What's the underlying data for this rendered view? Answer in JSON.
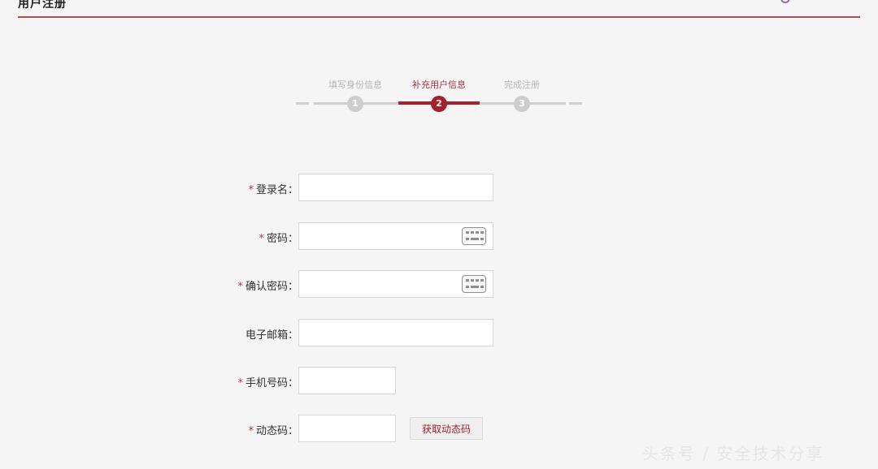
{
  "header": {
    "title": "用户注册",
    "accent_color": "#b54a55",
    "corner_icon": "circle-icon"
  },
  "stepper": {
    "steps": [
      {
        "label": "填写身份信息",
        "number": "1",
        "state": "done"
      },
      {
        "label": "补充用户信息",
        "number": "2",
        "state": "active"
      },
      {
        "label": "完成注册",
        "number": "3",
        "state": "pending"
      }
    ],
    "active_color": "#a3222e",
    "inactive_color": "#cdcdcd"
  },
  "form": {
    "fields": [
      {
        "label": "登录名：",
        "required": true,
        "value": "",
        "type": "text"
      },
      {
        "label": "密码：",
        "required": true,
        "value": "",
        "type": "password",
        "icon": "keyboard-icon"
      },
      {
        "label": "确认密码：",
        "required": true,
        "value": "",
        "type": "password",
        "icon": "keyboard-icon"
      },
      {
        "label": "电子邮箱：",
        "required": false,
        "value": "",
        "type": "text"
      },
      {
        "label": "手机号码：",
        "required": true,
        "value": "",
        "type": "text"
      },
      {
        "label": "动态码：",
        "required": true,
        "value": "",
        "type": "text"
      }
    ],
    "required_mark": "*",
    "get_code_label": "获取动态码"
  },
  "watermark": "头条号 / 安全技术分享"
}
